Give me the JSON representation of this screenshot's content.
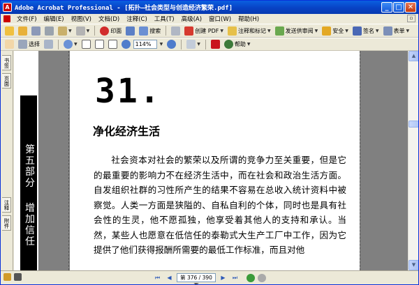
{
  "window": {
    "title": "Adobe Acrobat Professional - [拓扑—社会类型与创造经济繁荣.pdf]",
    "app_icon_glyph": "A",
    "buttons": {
      "minimize": "_",
      "maximize": "□",
      "close": "✕"
    }
  },
  "menu": {
    "items": [
      "文件(F)",
      "编辑(E)",
      "视图(V)",
      "文档(D)",
      "注释(C)",
      "工具(T)",
      "高级(A)",
      "窗口(W)",
      "帮助(H)"
    ],
    "restore_glyph": "▫"
  },
  "toolbar1": {
    "print_label": "",
    "search_label": "搜索",
    "create_pdf_label": "创建 PDF",
    "review_label": "注释和标记",
    "send_review_label": "发送供审阅",
    "secure_label": "安全",
    "sign_label": "签名",
    "forms_label": "表单"
  },
  "toolbar2": {
    "select_label": "选择",
    "zoom_value": "114%",
    "help_label": "帮助"
  },
  "navpane": {
    "tab1": "书签",
    "tab2": "页面",
    "tab3": "注释",
    "tab4": "附件"
  },
  "document": {
    "side_heading_1": "第五部分",
    "side_heading_2": "增加信任",
    "chapter_number": "31.",
    "chapter_title": "净化经济生活",
    "body_text": "社会资本对社会的繁荣以及所谓的竞争力至关重要，但是它的最重要的影响力不在经济生活中，而在社会和政治生活方面。自发组织社群的习性所产生的结果不容易在总收入统计资料中被察觉。人类一方面是狭隘的、自私自利的个体，同时也是具有社会性的生灵，他不愿孤独，他享受着其他人的支持和承认。当然，某些人也愿意在低信任的泰勒式大生产工厂中工作，因为它提供了他们获得报酬所需要的最低工作标准，而且对他"
  },
  "statusbar": {
    "page_display": "第 376 / 390 页"
  },
  "colors": {
    "titlebar": "#0842c4",
    "chrome": "#ece9d8",
    "doc_bg": "#808080"
  }
}
